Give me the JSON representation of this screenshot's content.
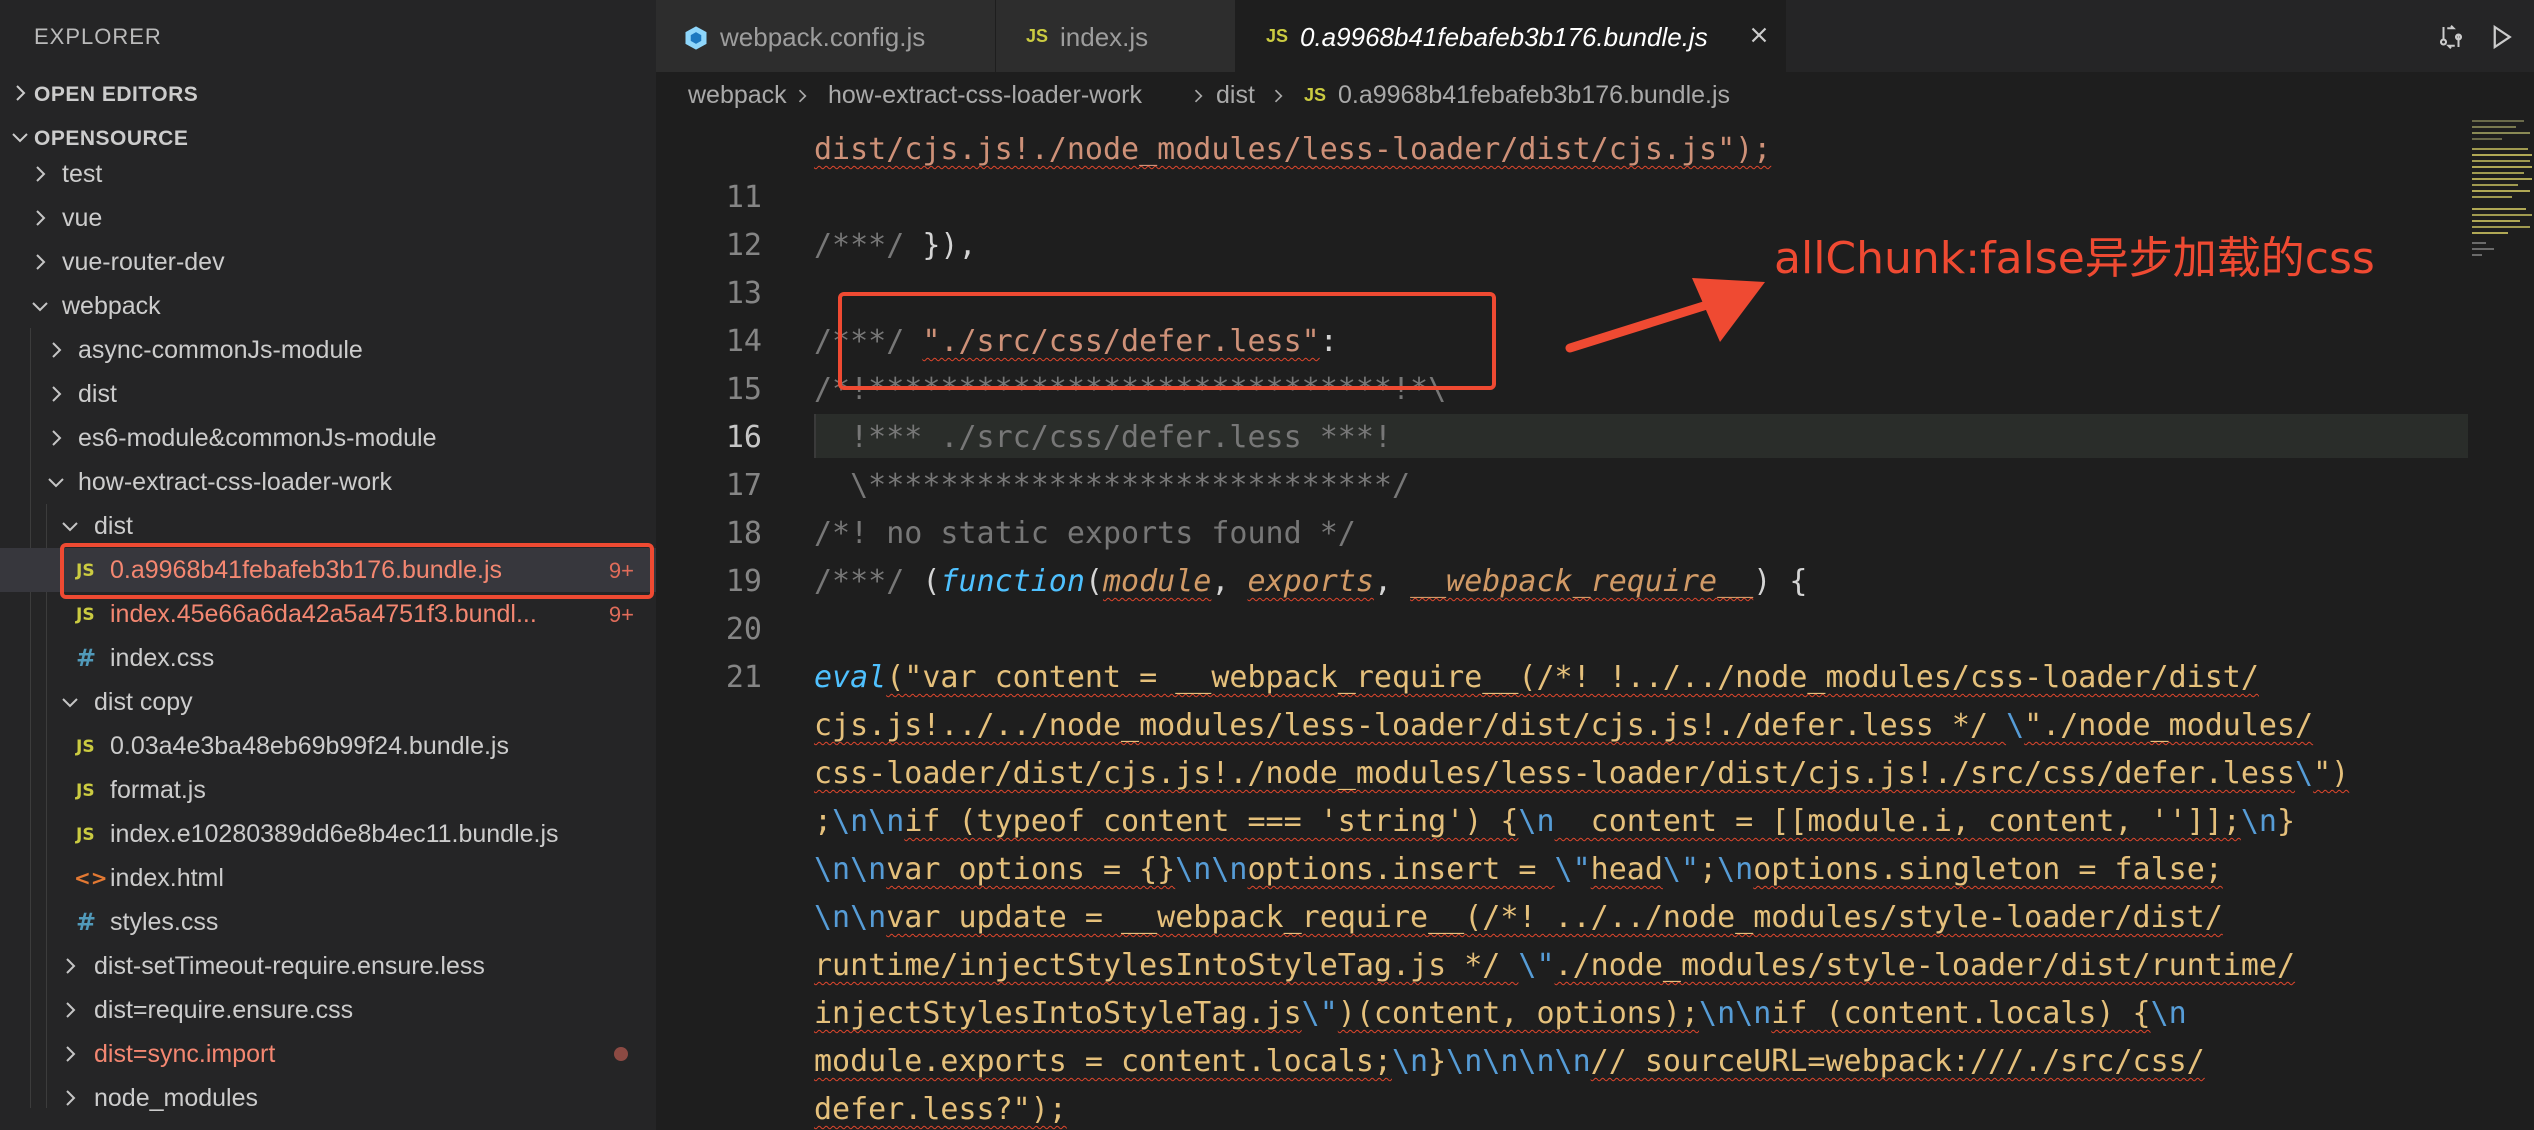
{
  "sidebar": {
    "title": "EXPLORER",
    "sections": {
      "open_editors": "OPEN EDITORS",
      "opensource": "OPENSOURCE"
    },
    "tree": [
      {
        "label": "test"
      },
      {
        "label": "vue"
      },
      {
        "label": "vue-router-dev"
      },
      {
        "label": "webpack"
      },
      {
        "label": "async-commonJs-module"
      },
      {
        "label": "dist"
      },
      {
        "label": "es6-module&commonJs-module"
      },
      {
        "label": "how-extract-css-loader-work"
      },
      {
        "label": "dist"
      },
      {
        "label": "0.a9968b41febafeb3b176.bundle.js",
        "badge": "9+"
      },
      {
        "label": "index.45e66a6da42a5a4751f3.bundl...",
        "badge": "9+"
      },
      {
        "label": "index.css"
      },
      {
        "label": "dist copy"
      },
      {
        "label": "0.03a4e3ba48eb69b99f24.bundle.js"
      },
      {
        "label": "format.js"
      },
      {
        "label": "index.e10280389dd6e8b4ec11.bundle.js"
      },
      {
        "label": "index.html"
      },
      {
        "label": "styles.css"
      },
      {
        "label": "dist-setTimeout-require.ensure.less"
      },
      {
        "label": "dist=require.ensure.css"
      },
      {
        "label": "dist=sync.import"
      },
      {
        "label": "node_modules"
      }
    ],
    "icon_glyphs": {
      "js": "JS",
      "css": "#",
      "html": "<>"
    }
  },
  "tabs": [
    {
      "label": "webpack.config.js",
      "icon": "webpack-icon"
    },
    {
      "label": "index.js",
      "icon": "js-file-icon"
    },
    {
      "label": "0.a9968b41febafeb3b176.bundle.js",
      "icon": "js-file-icon",
      "active": true
    }
  ],
  "breadcrumb": [
    "webpack",
    "how-extract-css-loader-work",
    "dist",
    "0.a9968b41febafeb3b176.bundle.js"
  ],
  "editor": {
    "line_numbers": [
      "11",
      "12",
      "13",
      "14",
      "15",
      "16",
      "17",
      "18",
      "19",
      "20",
      "21"
    ],
    "current_line": "16",
    "top_partial_line": "dist/cjs.js!./node_modules/less-loader/dist/cjs.js\");",
    "l12": [
      "/***/",
      " }),"
    ],
    "l14": [
      "/***/",
      " ",
      "\"./src/css/defer.less\"",
      ":"
    ],
    "l15": "/*!*****************************!*\\",
    "l16": "  !*** ./src/css/defer.less ***!",
    "l17": "  \\*****************************/",
    "l18": "/*! no static exports found */",
    "l19": [
      "/***/",
      " (",
      "function",
      "(",
      "module",
      ", ",
      "exports",
      ", ",
      "__webpack_require__",
      ") {"
    ],
    "eval_lines": [
      [
        "eval",
        "(\"var content = __webpack_require__(/*! !../../node_modules/css-loader/dist/"
      ],
      [
        "cjs.js!../../node_modules/less-loader/dist/cjs.js!./defer.less */ ",
        "\\",
        "\"./node_modules/"
      ],
      [
        "css-loader/dist/cjs.js!./node_modules/less-loader/dist/cjs.js!./src/css/defer.less",
        "\\",
        "\")"
      ],
      [
        ";",
        "\\n\\n",
        "if (typeof content === 'string') {",
        "\\n",
        "  content = [[module.i, content, '']];",
        "\\n",
        "}"
      ],
      [
        "\\n\\n",
        "var options = {}",
        "\\n\\n",
        "options.insert = ",
        "\\\"",
        "head",
        "\\\"",
        ";",
        "\\n",
        "options.singleton = false;"
      ],
      [
        "\\n\\n",
        "var update = __webpack_require__(/*! ../../node_modules/style-loader/dist/"
      ],
      [
        "runtime/injectStylesIntoStyleTag.js */ ",
        "\\\"",
        "./node_modules/style-loader/dist/runtime/"
      ],
      [
        "injectStylesIntoStyleTag.js",
        "\\\"",
        ")(content, options);",
        "\\n\\n",
        "if (content.locals) {",
        "\\n"
      ],
      [
        "module.exports = content.locals;",
        "\\n",
        "}",
        "\\n\\n\\n\\n",
        "// sourceURL=webpack:///./src/css/"
      ],
      [
        "defer.less?\");"
      ]
    ]
  },
  "annotation": {
    "text": "allChunk:false异步加载的css",
    "color": "#ef4a32"
  },
  "colors": {
    "accent_red": "#ef4a32",
    "error_text": "#f48771",
    "js_icon": "#cbcb41",
    "css_icon": "#519aba"
  }
}
